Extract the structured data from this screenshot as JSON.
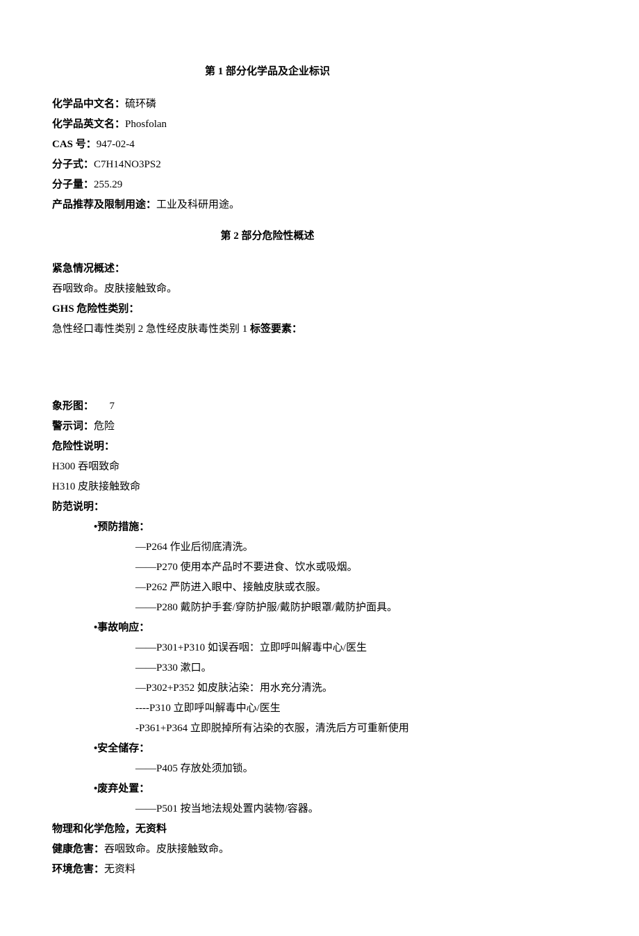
{
  "section1": {
    "title": "第 1 部分化学品及企业标识",
    "name_cn_label": "化学品中文名：",
    "name_cn_value": "硫环磷",
    "name_en_label": "化学品英文名：",
    "name_en_value": "Phosfolan",
    "cas_label": "CAS 号：",
    "cas_value": "947-02-4",
    "formula_label": "分子式：",
    "formula_value": "C7H14NO3PS2",
    "mw_label": "分子量：",
    "mw_value": "255.29",
    "use_label": "产品推荐及限制用途：",
    "use_value": "工业及科研用途。"
  },
  "section2": {
    "title": "第 2 部分危险性概述",
    "emergency_label": "紧急情况概述：",
    "emergency_value": "吞咽致命。皮肤接触致命。",
    "ghs_label": "GHS 危险性类别：",
    "ghs_value": "急性经口毒性类别 2 急性经皮肤毒性类别 1 ",
    "label_elements": "标签要素：",
    "pictogram_label": "象形图：",
    "pictogram_value": "7",
    "signal_label": "警示词：",
    "signal_value": "危险",
    "hazard_stmt_label": "危险性说明：",
    "h300": "H300 吞咽致命",
    "h310": "H310 皮肤接触致命",
    "precaution_label": "防范说明：",
    "prevention_label": "•预防措施：",
    "p264": "—P264 作业后彻底清洗。",
    "p270": "——P270 使用本产品时不要进食、饮水或吸烟。",
    "p262": "—P262 严防进入眼中、接触皮肤或衣服。",
    "p280": "——P280 戴防护手套/穿防护服/戴防护眼罩/戴防护面具。",
    "response_label": "•事故响应：",
    "p301_310": "——P301+P310 如误吞咽：立即呼叫解毒中心/医生",
    "p330": "——P330 漱口。",
    "p302_352": "—P302+P352 如皮肤沾染：用水充分清洗。",
    "p310": "----P310 立即呼叫解毒中心/医生",
    "p361_364": "-P361+P364 立即脱掉所有沾染的衣服，清洗后方可重新使用",
    "storage_label": "•安全储存：",
    "p405": "——P405 存放处须加锁。",
    "disposal_label": "•废弃处置：",
    "p501": "——P501 按当地法规处置内装物/容器。",
    "phys_chem_label": "物理和化学危险，无资料",
    "health_label": "健康危害：",
    "health_value": "吞咽致命。皮肤接触致命。",
    "env_label": "环境危害：",
    "env_value": "无资料"
  }
}
